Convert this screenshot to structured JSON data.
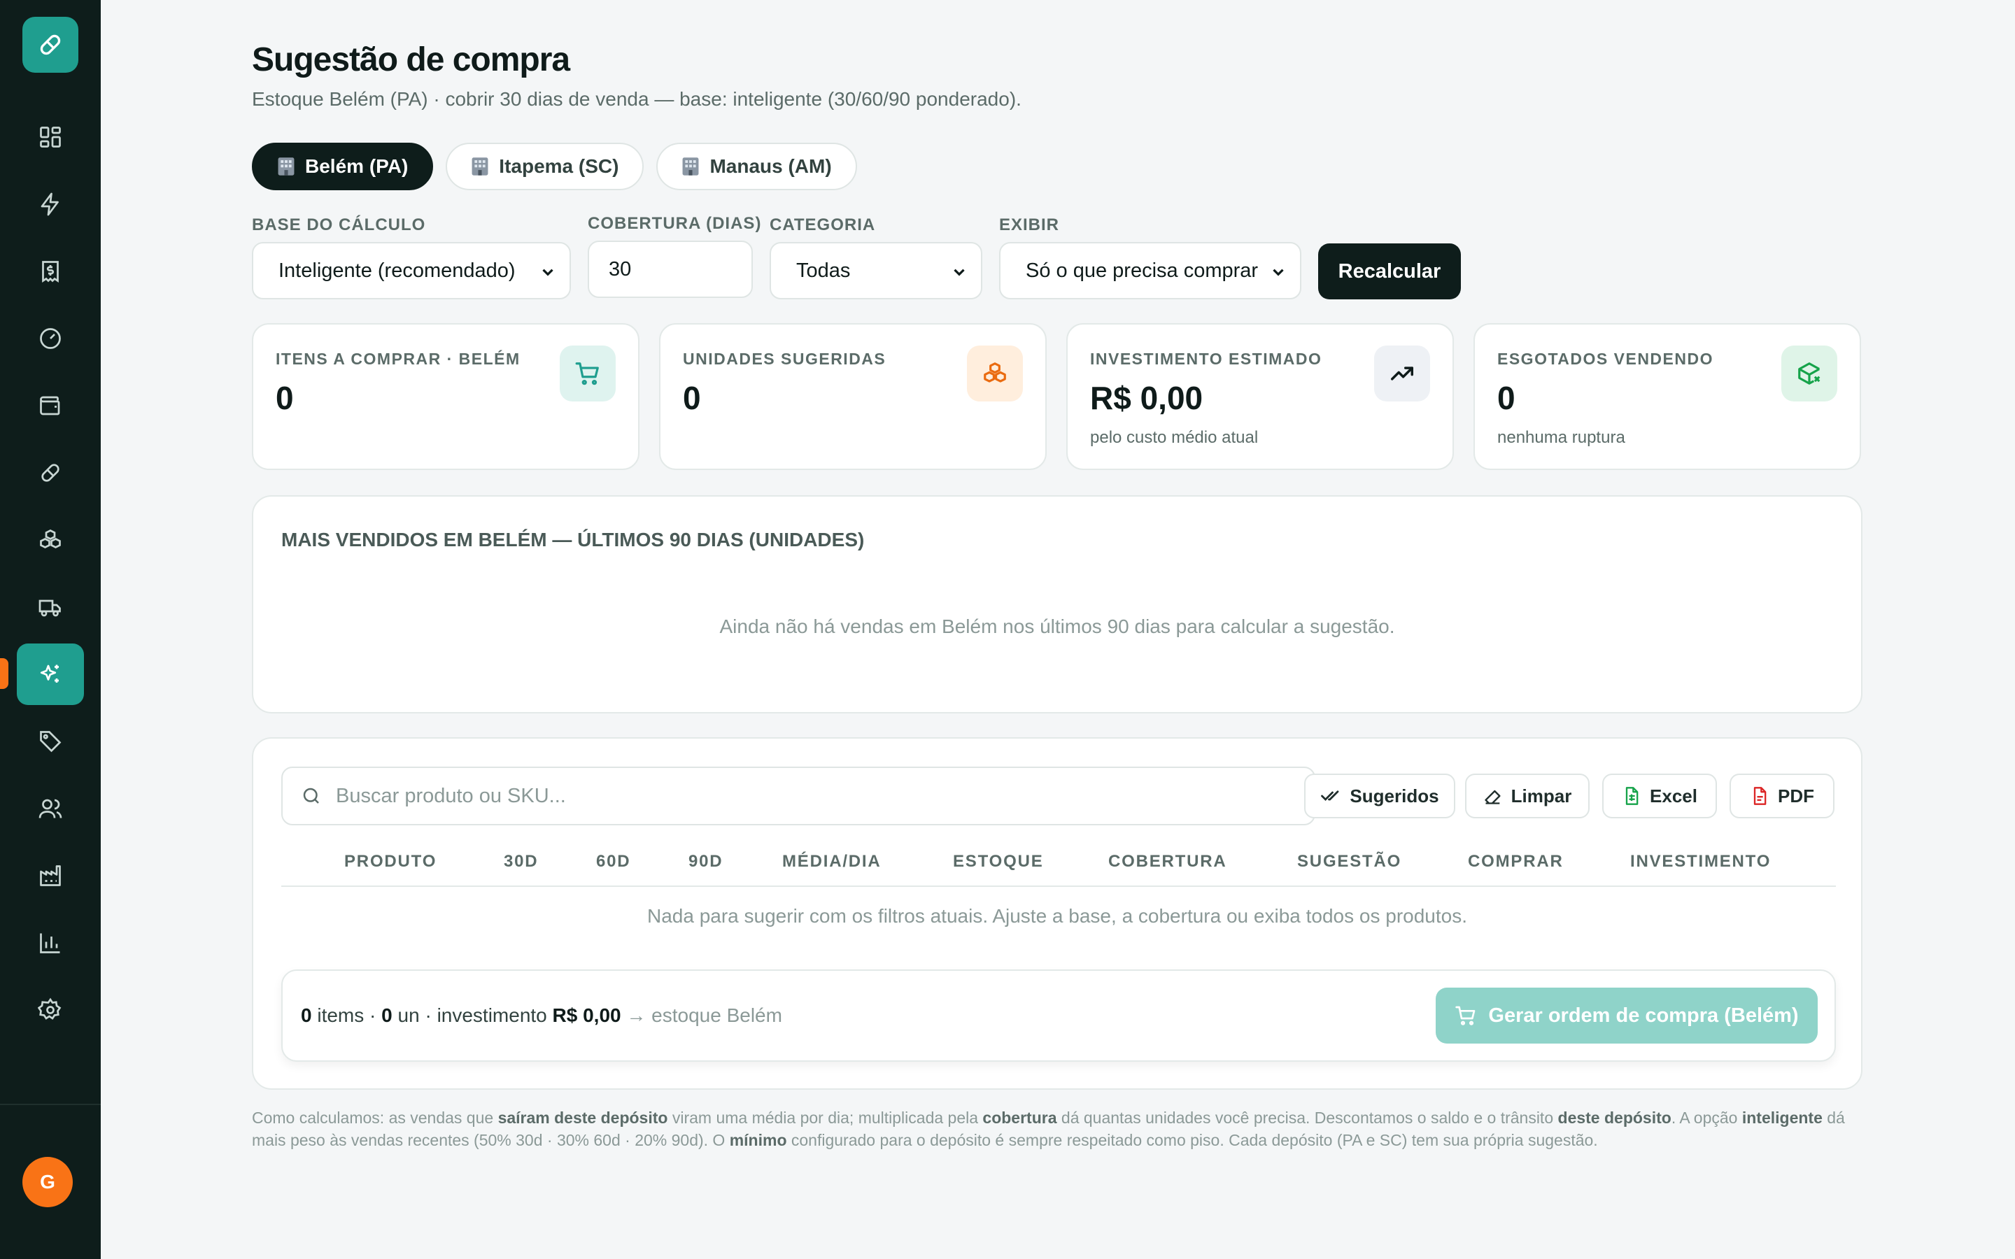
{
  "sidebar": {
    "avatar_initial": "G",
    "items": [
      {
        "name": "dashboard",
        "icon": "grid-icon"
      },
      {
        "name": "activity",
        "icon": "bolt-icon"
      },
      {
        "name": "finance",
        "icon": "receipt-icon"
      },
      {
        "name": "performance",
        "icon": "gauge-icon"
      },
      {
        "name": "wallet",
        "icon": "wallet-icon"
      },
      {
        "name": "products",
        "icon": "pill-icon"
      },
      {
        "name": "stock",
        "icon": "boxes-icon"
      },
      {
        "name": "shipping",
        "icon": "truck-icon"
      },
      {
        "name": "suggestion",
        "icon": "sparkles-icon",
        "active": true
      },
      {
        "name": "tags",
        "icon": "tag-icon"
      },
      {
        "name": "users",
        "icon": "users-icon"
      },
      {
        "name": "factory",
        "icon": "factory-icon"
      },
      {
        "name": "reports",
        "icon": "chart-icon"
      },
      {
        "name": "settings",
        "icon": "gear-icon"
      }
    ]
  },
  "header": {
    "title": "Sugestão de compra",
    "subtitle": "Estoque Belém (PA) · cobrir 30 dias de venda — base: inteligente (30/60/90 ponderado)."
  },
  "tabs": [
    {
      "label": "Belém (PA)",
      "active": true
    },
    {
      "label": "Itapema (SC)",
      "active": false
    },
    {
      "label": "Manaus (AM)",
      "active": false
    }
  ],
  "filters": {
    "base_label": "BASE DO CÁLCULO",
    "base_value": "Inteligente (recomendado)",
    "coverage_label": "COBERTURA (DIAS)",
    "coverage_value": "30",
    "category_label": "CATEGORIA",
    "category_value": "Todas",
    "show_label": "EXIBIR",
    "show_value": "Só o que precisa comprar",
    "recalc_label": "Recalcular"
  },
  "kpis": [
    {
      "label": "ITENS A COMPRAR · BELÉM",
      "value": "0",
      "note": "",
      "icon": "cart-icon"
    },
    {
      "label": "UNIDADES SUGERIDAS",
      "value": "0",
      "note": "",
      "icon": "boxes-icon"
    },
    {
      "label": "INVESTIMENTO ESTIMADO",
      "value": "R$ 0,00",
      "note": "pelo custo médio atual",
      "icon": "trending-up-icon"
    },
    {
      "label": "ESGOTADOS VENDENDO",
      "value": "0",
      "note": "nenhuma ruptura",
      "icon": "package-x-icon"
    }
  ],
  "top_sellers": {
    "title": "MAIS VENDIDOS EM BELÉM — ÚLTIMOS 90 DIAS (UNIDADES)",
    "empty": "Ainda não há vendas em Belém nos últimos 90 dias para calcular a sugestão."
  },
  "table": {
    "search_placeholder": "Buscar produto ou SKU...",
    "buttons": {
      "suggested": "Sugeridos",
      "clear": "Limpar",
      "excel": "Excel",
      "pdf": "PDF"
    },
    "columns": [
      "PRODUTO",
      "30D",
      "60D",
      "90D",
      "MÉDIA/DIA",
      "ESTOQUE",
      "COBERTURA",
      "SUGESTÃO",
      "COMPRAR",
      "INVESTIMENTO"
    ],
    "empty": "Nada para sugerir com os filtros atuais. Ajuste a base, a cobertura ou exiba todos os produtos."
  },
  "summary": {
    "items_count": "0",
    "items_word": "items",
    "units_count": "0",
    "units_word": "un",
    "investment_word": "investimento",
    "investment_value": "R$ 0,00",
    "target": "→ estoque Belém",
    "generate_label": "Gerar ordem de compra (Belém)"
  },
  "footnote": {
    "p1": "Como calculamos: as vendas que ",
    "b1": "saíram deste depósito",
    "p2": " viram uma média por dia; multiplicada pela ",
    "b2": "cobertura",
    "p3": " dá quantas unidades você precisa. Descontamos o saldo e o trânsito ",
    "b3": "deste depósito",
    "p4": ". A opção ",
    "b4": "inteligente",
    "p5": " dá mais peso às vendas recentes (50% 30d · 30% 60d · 20% 90d). O ",
    "b5": "mínimo",
    "p6": " configurado para o depósito é sempre respeitado como piso. Cada depósito (PA e SC) tem sua própria sugestão."
  },
  "colors": {
    "accent": "#1f9e8f",
    "sidebar_bg": "#0e1d1b",
    "active_marker": "#f97316",
    "button_disabled": "#8fd3c9"
  }
}
